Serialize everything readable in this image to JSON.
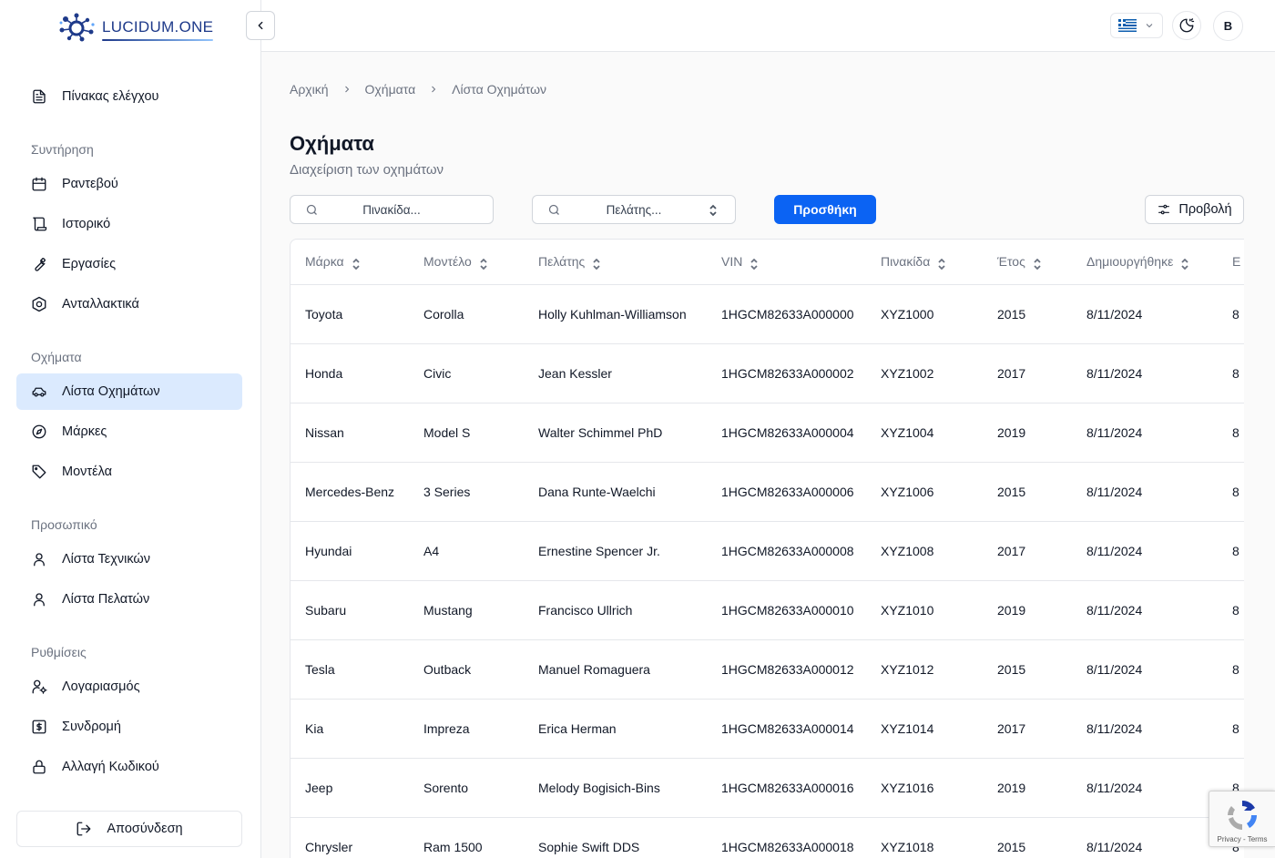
{
  "brand": {
    "name": "LUCIDUM.ONE",
    "colors": {
      "primary": "#0b63f3",
      "active_bg": "#dbeafe",
      "logo": "#1e3a8a"
    }
  },
  "sidebar": {
    "top_item": {
      "label": "Πίνακας ελέγχου",
      "icon": "document-icon"
    },
    "sections": [
      {
        "title": "Συντήρηση",
        "items": [
          {
            "label": "Ραντεβού",
            "icon": "calendar-icon"
          },
          {
            "label": "Ιστορικό",
            "icon": "scroll-icon"
          },
          {
            "label": "Εργασίες",
            "icon": "wrench-icon"
          },
          {
            "label": "Ανταλλακτικά",
            "icon": "hex-nut-icon"
          }
        ]
      },
      {
        "title": "Οχήματα",
        "items": [
          {
            "label": "Λίστα Οχημάτων",
            "icon": "car-icon",
            "active": true
          },
          {
            "label": "Μάρκες",
            "icon": "compass-icon"
          },
          {
            "label": "Μοντέλα",
            "icon": "tag-icon"
          }
        ]
      },
      {
        "title": "Προσωπικό",
        "items": [
          {
            "label": "Λίστα Τεχνικών",
            "icon": "user-icon"
          },
          {
            "label": "Λίστα Πελατών",
            "icon": "user-icon"
          }
        ]
      },
      {
        "title": "Ρυθμίσεις",
        "items": [
          {
            "label": "Λογαριασμός",
            "icon": "user-cog-icon"
          },
          {
            "label": "Συνδρομή",
            "icon": "dollar-icon"
          },
          {
            "label": "Αλλαγή Κωδικού",
            "icon": "lock-icon"
          }
        ]
      }
    ],
    "logout_label": "Αποσύνδεση"
  },
  "topbar": {
    "language_flag": "greek-flag-icon",
    "theme_icon": "moon-sun-icon",
    "avatar_initial": "B"
  },
  "breadcrumb": [
    "Αρχική",
    "Οχήματα",
    "Λίστα Οχημάτων"
  ],
  "page": {
    "title": "Οχήματα",
    "subtitle": "Διαχείριση των οχημάτων"
  },
  "filters": {
    "plate_placeholder": "Πινακίδα...",
    "customer_placeholder": "Πελάτης...",
    "add_label": "Προσθήκη",
    "view_label": "Προβολή"
  },
  "table": {
    "columns": [
      "Μάρκα",
      "Μοντέλο",
      "Πελάτης",
      "VIN",
      "Πινακίδα",
      "Έτος",
      "Δημιουργήθηκε",
      "Ε"
    ],
    "rows": [
      [
        "Toyota",
        "Corolla",
        "Holly Kuhlman-Williamson",
        "1HGCM82633A000000",
        "XYZ1000",
        "2015",
        "8/11/2024",
        "8"
      ],
      [
        "Honda",
        "Civic",
        "Jean Kessler",
        "1HGCM82633A000002",
        "XYZ1002",
        "2017",
        "8/11/2024",
        "8"
      ],
      [
        "Nissan",
        "Model S",
        "Walter Schimmel PhD",
        "1HGCM82633A000004",
        "XYZ1004",
        "2019",
        "8/11/2024",
        "8"
      ],
      [
        "Mercedes-Benz",
        "3 Series",
        "Dana Runte-Waelchi",
        "1HGCM82633A000006",
        "XYZ1006",
        "2015",
        "8/11/2024",
        "8"
      ],
      [
        "Hyundai",
        "A4",
        "Ernestine Spencer Jr.",
        "1HGCM82633A000008",
        "XYZ1008",
        "2017",
        "8/11/2024",
        "8"
      ],
      [
        "Subaru",
        "Mustang",
        "Francisco Ullrich",
        "1HGCM82633A000010",
        "XYZ1010",
        "2019",
        "8/11/2024",
        "8"
      ],
      [
        "Tesla",
        "Outback",
        "Manuel Romaguera",
        "1HGCM82633A000012",
        "XYZ1012",
        "2015",
        "8/11/2024",
        "8"
      ],
      [
        "Kia",
        "Impreza",
        "Erica Herman",
        "1HGCM82633A000014",
        "XYZ1014",
        "2017",
        "8/11/2024",
        "8"
      ],
      [
        "Jeep",
        "Sorento",
        "Melody Bogisich-Bins",
        "1HGCM82633A000016",
        "XYZ1016",
        "2019",
        "8/11/2024",
        "8"
      ],
      [
        "Chrysler",
        "Ram 1500",
        "Sophie Swift DDS",
        "1HGCM82633A000018",
        "XYZ1018",
        "2015",
        "8/11/2024",
        "8"
      ]
    ]
  },
  "recaptcha": {
    "terms": "Privacy - Terms"
  }
}
